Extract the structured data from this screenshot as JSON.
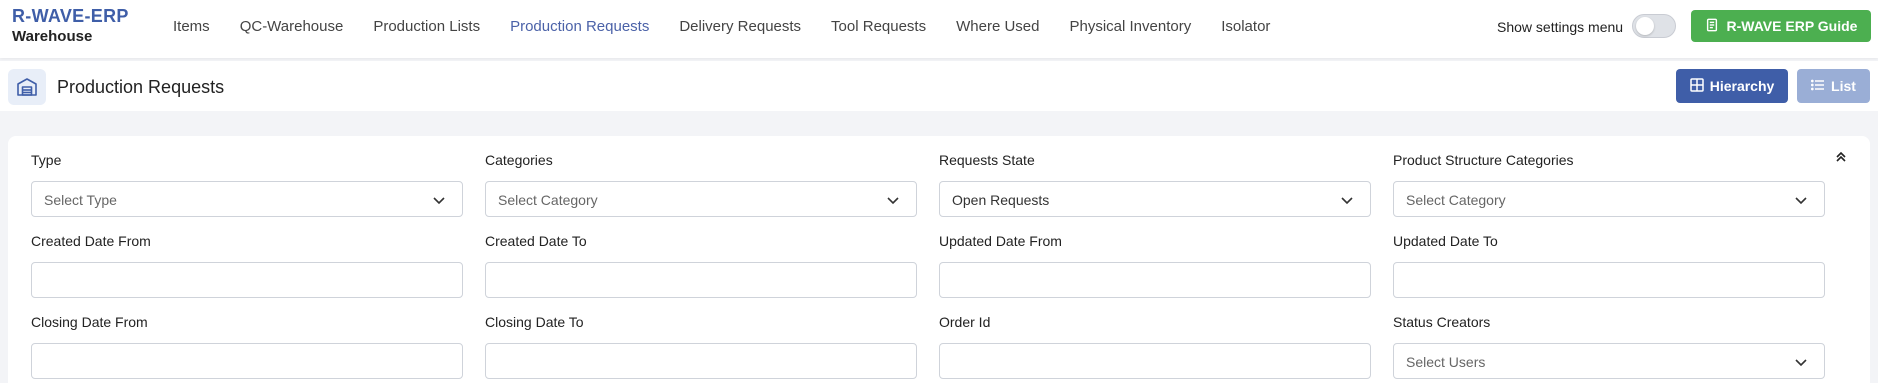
{
  "brand": {
    "name": "R-WAVE-ERP",
    "module": "Warehouse"
  },
  "nav": [
    {
      "label": "Items",
      "active": false
    },
    {
      "label": "QC-Warehouse",
      "active": false
    },
    {
      "label": "Production Lists",
      "active": false
    },
    {
      "label": "Production Requests",
      "active": true
    },
    {
      "label": "Delivery Requests",
      "active": false
    },
    {
      "label": "Tool Requests",
      "active": false
    },
    {
      "label": "Where Used",
      "active": false
    },
    {
      "label": "Physical Inventory",
      "active": false
    },
    {
      "label": "Isolator",
      "active": false
    }
  ],
  "settings": {
    "label": "Show settings menu",
    "enabled": false
  },
  "guide": {
    "label": "R-WAVE ERP Guide",
    "icon": "book-icon"
  },
  "page": {
    "title": "Production Requests",
    "icon": "warehouse-icon",
    "view_buttons": {
      "hierarchy": "Hierarchy",
      "list": "List"
    }
  },
  "filters": {
    "type": {
      "label": "Type",
      "placeholder": "Select Type"
    },
    "categories": {
      "label": "Categories",
      "placeholder": "Select Category"
    },
    "requests_state": {
      "label": "Requests State",
      "value": "Open Requests"
    },
    "product_structure_categories": {
      "label": "Product Structure Categories",
      "placeholder": "Select Category"
    },
    "created_date_from": {
      "label": "Created Date From",
      "value": ""
    },
    "created_date_to": {
      "label": "Created Date To",
      "value": ""
    },
    "updated_date_from": {
      "label": "Updated Date From",
      "value": ""
    },
    "updated_date_to": {
      "label": "Updated Date To",
      "value": ""
    },
    "closing_date_from": {
      "label": "Closing Date From",
      "value": ""
    },
    "closing_date_to": {
      "label": "Closing Date To",
      "value": ""
    },
    "order_id": {
      "label": "Order Id",
      "value": ""
    },
    "status_creators": {
      "label": "Status Creators",
      "placeholder": "Select Users"
    }
  },
  "colors": {
    "brand": "#3f5ea8",
    "accent_green": "#4caf50",
    "list_button": "#9aaed6",
    "active_nav": "#4b62a8"
  }
}
